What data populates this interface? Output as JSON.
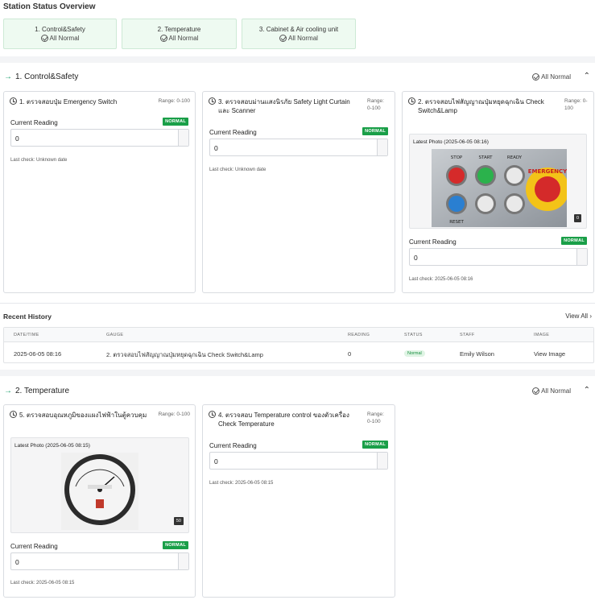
{
  "page": {
    "title": "Station Status Overview"
  },
  "summary": [
    {
      "name": "1. Control&Safety",
      "status": "All Normal"
    },
    {
      "name": "2. Temperature",
      "status": "All Normal"
    },
    {
      "name": "3. Cabinet & Air cooling unit",
      "status": "All Normal"
    }
  ],
  "sections": [
    {
      "title": "1. Control&Safety",
      "status": "All Normal",
      "gauges": [
        {
          "title": "1. ตรวจสอบปุ่ม Emergency Switch",
          "range": "Range: 0-100",
          "reading_label": "Current Reading",
          "badge": "NORMAL",
          "value": "0",
          "last_check": "Last check: Unknown date"
        },
        {
          "title": "3. ตรวจสอบม่านแสงนิรภัย Safety Light Curtain และ Scanner",
          "range": "Range: 0-100",
          "reading_label": "Current Reading",
          "badge": "NORMAL",
          "value": "0",
          "last_check": "Last check: Unknown date"
        },
        {
          "title": "2. ตรวจสอบไฟสัญญาณปุ่มหยุดฉุกเฉิน Check Switch&Lamp",
          "range": "Range: 0-100",
          "photo_label": "Latest Photo (2025-06-05 08:16)",
          "photo_count": "0",
          "reading_label": "Current Reading",
          "badge": "NORMAL",
          "value": "0",
          "last_check": "Last check: 2025-06-05 08:16"
        }
      ]
    },
    {
      "title": "2. Temperature",
      "status": "All Normal",
      "gauges": [
        {
          "title": "5. ตรวจสอบอุณหภูมิของแผงไฟฟ้าในตู้ควบคุม",
          "range": "Range: 0-100",
          "photo_label": "Latest Photo (2025-06-05 08:15)",
          "photo_count": "50",
          "reading_label": "Current Reading",
          "badge": "NORMAL",
          "value": "0",
          "last_check": "Last check: 2025-06-05 08:15"
        },
        {
          "title": "4. ตรวจสอบ Temperature control ของตัวเครื่อง Check Temperature",
          "range": "Range: 0-100",
          "reading_label": "Current Reading",
          "badge": "NORMAL",
          "value": "0",
          "last_check": "Last check: 2025-06-05 08:15"
        }
      ]
    }
  ],
  "history": {
    "title": "Recent History",
    "view_all": "View All",
    "columns": [
      "DATE/TIME",
      "GAUGE",
      "READING",
      "STATUS",
      "STAFF",
      "IMAGE"
    ],
    "rows": [
      {
        "datetime": "2025-06-05 08:16",
        "gauge": "2. ตรวจสอบไฟสัญญาณปุ่มหยุดฉุกเฉิน Check Switch&Lamp",
        "reading": "0",
        "status": "Normal",
        "staff": "Emily Wilson",
        "image": "View Image"
      }
    ]
  },
  "panel_labels": {
    "stop": "STOP",
    "start": "START",
    "ready": "READY",
    "reset": "RESET",
    "emergency": "EMERGENCY"
  },
  "colors": {
    "normal_badge": "#1a9f48",
    "accent_arrow": "#1a9f6b",
    "summary_bg": "#eefaf1",
    "link": "#2f6fd1"
  }
}
